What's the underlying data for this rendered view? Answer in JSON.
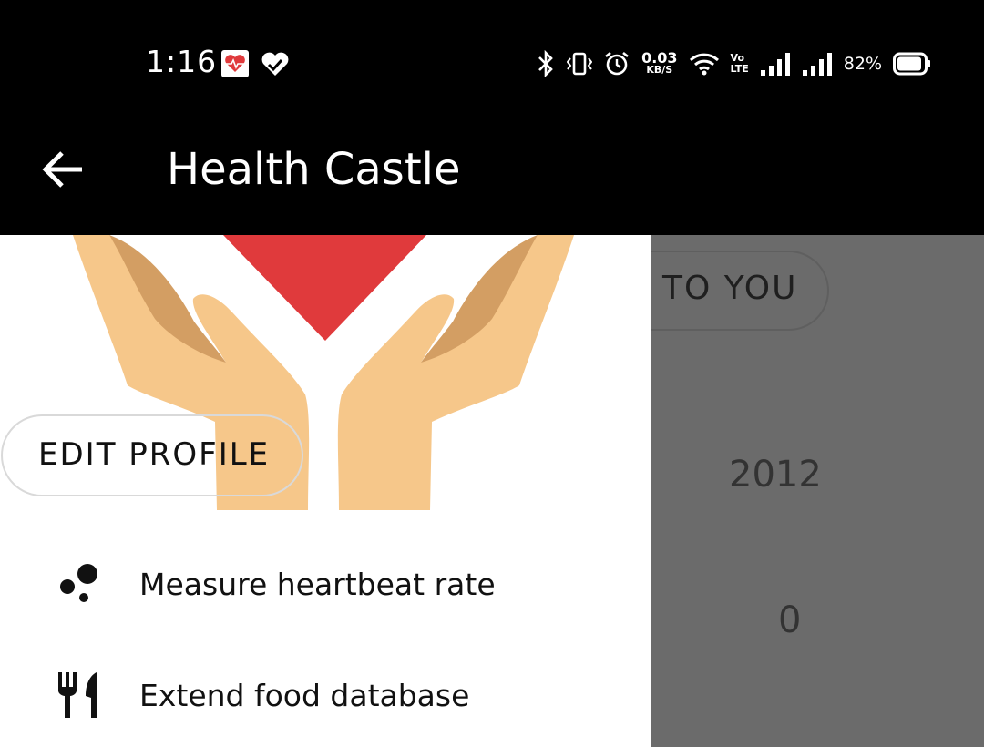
{
  "status_bar": {
    "time": "1:16",
    "network_speed_value": "0.03",
    "network_speed_unit": "KB/S",
    "volte_top": "Vo",
    "volte_bottom": "LTE",
    "battery_percent": "82%"
  },
  "app_bar": {
    "title": "Health Castle",
    "back_icon": "arrow-back-icon"
  },
  "drawer": {
    "header_image": "hands-holding-heart-illustration",
    "edit_profile_label": "EDIT PROFILE",
    "menu_items": [
      {
        "label": "Measure heartbeat rate",
        "icon": "heartbeat-dots-icon"
      },
      {
        "label": "Extend food database",
        "icon": "fork-knife-icon"
      }
    ]
  },
  "background": {
    "button_label": "TO YOU",
    "value_1": "2012",
    "value_2": "0"
  },
  "colors": {
    "heart": "#e03a3c",
    "hand_light": "#f6c78a",
    "hand_shade": "#d39e63",
    "scrim": "#6b6b6b"
  }
}
